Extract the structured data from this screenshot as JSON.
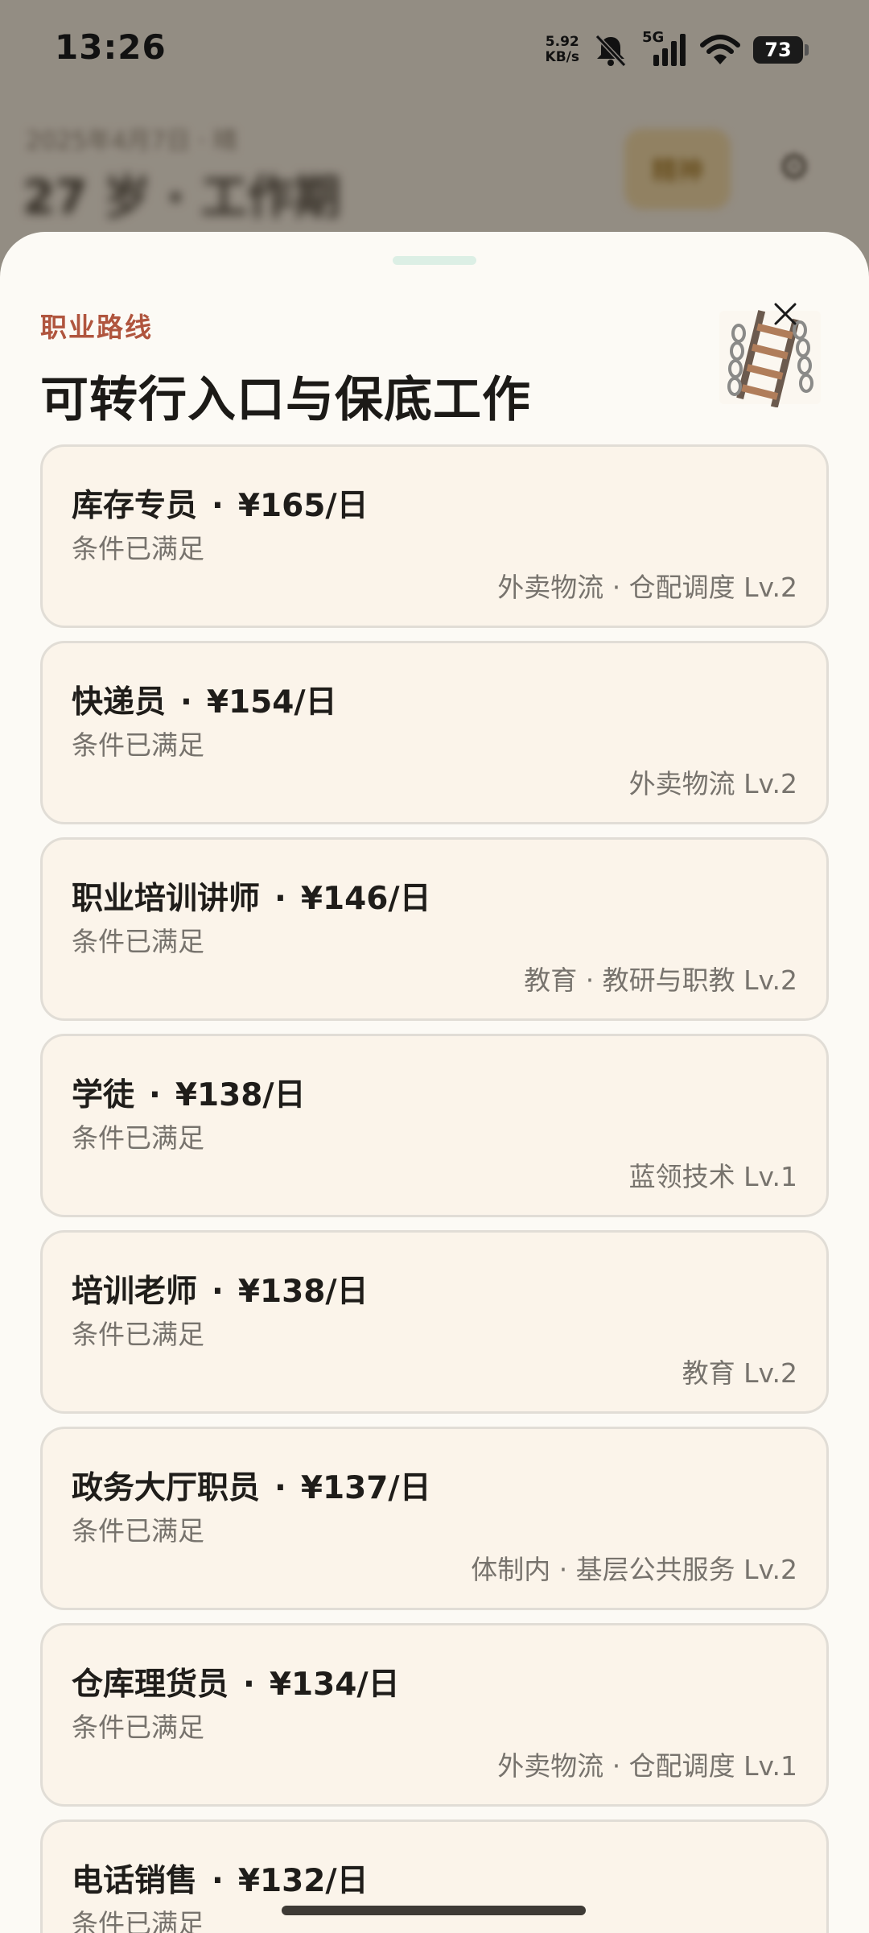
{
  "status_bar": {
    "time": "13:26",
    "net_speed_value": "5.92",
    "net_speed_unit": "KB/s",
    "network_type": "5G",
    "battery_level": "73"
  },
  "background": {
    "subtitle": "2025年4月7日 · 晴",
    "title": "27 岁 · 工作期",
    "badge_label": "精神"
  },
  "sheet": {
    "eyebrow": "职业路线",
    "title": "可转行入口与保底工作",
    "separator": "·",
    "jobs": [
      {
        "name": "库存专员",
        "wage": "¥165/日",
        "status": "条件已满足",
        "tag": "外卖物流 · 仓配调度 Lv.2"
      },
      {
        "name": "快递员",
        "wage": "¥154/日",
        "status": "条件已满足",
        "tag": "外卖物流 Lv.2"
      },
      {
        "name": "职业培训讲师",
        "wage": "¥146/日",
        "status": "条件已满足",
        "tag": "教育 · 教研与职教 Lv.2"
      },
      {
        "name": "学徒",
        "wage": "¥138/日",
        "status": "条件已满足",
        "tag": "蓝领技术 Lv.1"
      },
      {
        "name": "培训老师",
        "wage": "¥138/日",
        "status": "条件已满足",
        "tag": "教育 Lv.2"
      },
      {
        "name": "政务大厅职员",
        "wage": "¥137/日",
        "status": "条件已满足",
        "tag": "体制内 · 基层公共服务 Lv.2"
      },
      {
        "name": "仓库理货员",
        "wage": "¥134/日",
        "status": "条件已满足",
        "tag": "外卖物流 · 仓配调度 Lv.1"
      },
      {
        "name": "电话销售",
        "wage": "¥132/日",
        "status": "条件已满足",
        "tag": ""
      }
    ]
  }
}
